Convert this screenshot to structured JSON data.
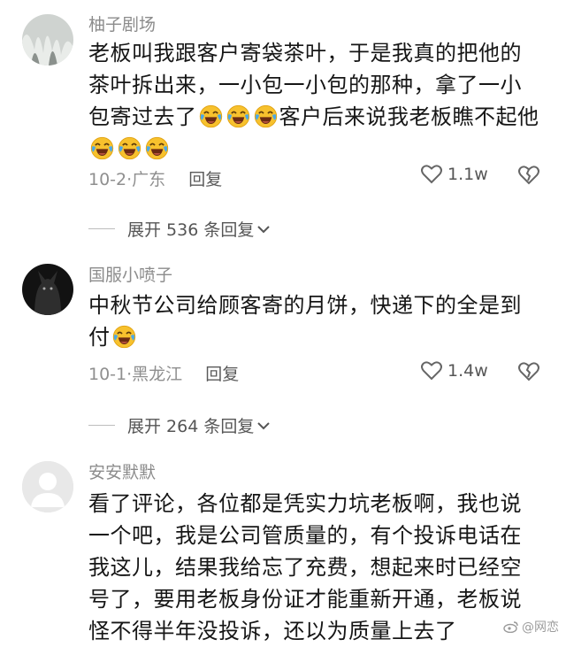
{
  "comments": [
    {
      "username": "柚子剧场",
      "text_parts": [
        "老板叫我跟客户寄袋茶叶，于是我真的把他的茶叶拆出来，一小包一小包的那种，拿了一小包寄过去了",
        "客户后来说我老板瞧不起他"
      ],
      "emoji": "crying-laughing-emoji",
      "date": "10-2·",
      "location": "广东",
      "reply_label": "回复",
      "likes": "1.1w",
      "expand_label": "展开 536 条回复"
    },
    {
      "username": "国服小喷子",
      "text_parts": [
        "中秋节公司给顾客寄的月饼，快递下的全是到付"
      ],
      "emoji": "crying-laughing-emoji",
      "date": "10-1·",
      "location": "黑龙江",
      "reply_label": "回复",
      "likes": "1.4w",
      "expand_label": "展开 264 条回复"
    },
    {
      "username": "安安默默",
      "text_parts": [
        "看了评论，各位都是凭实力坑老板啊，我也说一个吧，我是公司管质量的，有个投诉电话在我这儿，结果我给忘了充费，想起来时已经空号了，要用老板身份证才能重新开通，老板说怪不得半年没投诉，还以为质量上去了"
      ]
    }
  ],
  "watermark": "@网恋",
  "icons": {
    "like": "heart-outline-icon",
    "dislike": "broken-heart-icon",
    "expand": "chevron-down-icon"
  }
}
